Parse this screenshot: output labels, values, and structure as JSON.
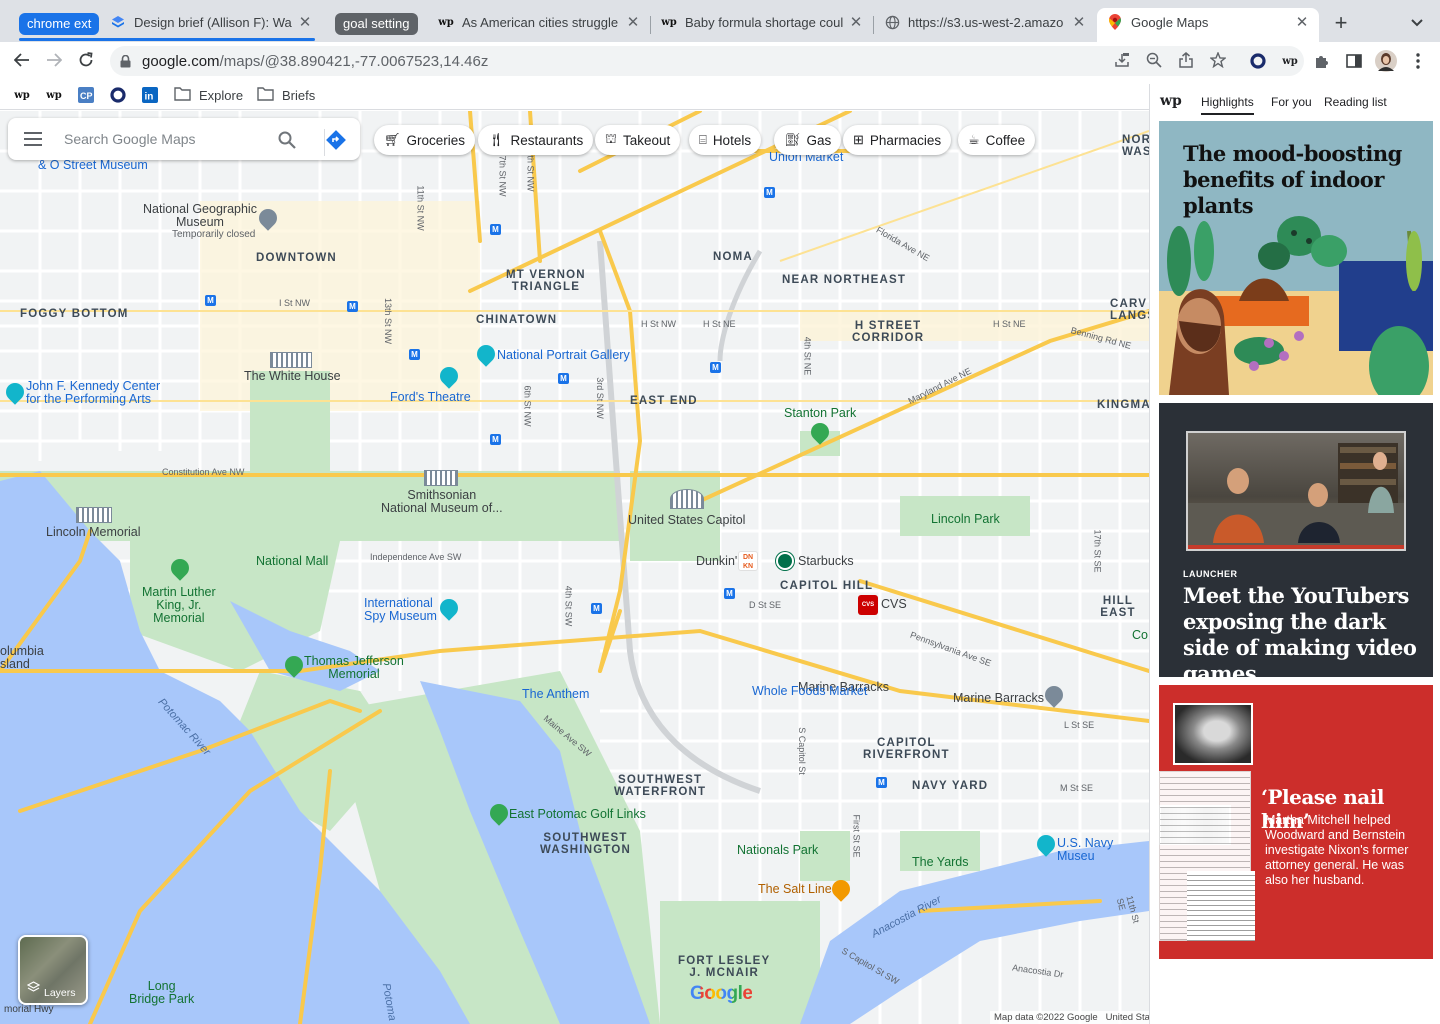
{
  "tabs": {
    "groups": [
      {
        "label": "chrome ext",
        "color": "#1a73e8"
      },
      {
        "label": "goal setting",
        "color": "#5f6368"
      }
    ],
    "items": [
      {
        "title": "Design brief (Allison F): Was",
        "icon": "design-doc-icon"
      },
      {
        "title": "As American cities struggle",
        "icon": "wapo-icon"
      },
      {
        "title": "Baby formula shortage coul",
        "icon": "wapo-icon"
      },
      {
        "title": "https://s3.us-west-2.amazo",
        "icon": "globe-icon"
      },
      {
        "title": "Google Maps",
        "icon": "google-maps-icon"
      }
    ]
  },
  "toolbar": {
    "url_host": "google.com",
    "url_path": "/maps/@38.890421,-77.0067523,14.46z"
  },
  "bookmarks": {
    "folders": [
      "Explore",
      "Briefs"
    ]
  },
  "map": {
    "search_placeholder": "Search Google Maps",
    "chips": [
      "Groceries",
      "Restaurants",
      "Takeout",
      "Hotels",
      "Gas",
      "Pharmacies",
      "Coffee"
    ],
    "areas": {
      "downtown": "DOWNTOWN",
      "foggy_bottom": "FOGGY BOTTOM",
      "mt_vernon": "MT VERNON\nTRIANGLE",
      "chinatown": "CHINATOWN",
      "noma": "NOMA",
      "near_northeast": "NEAR NORTHEAST",
      "h_street": "H STREET\nCORRIDOR",
      "east_end": "EAST END",
      "kingman": "KINGMA",
      "carver": "CARV\nLANGS",
      "capitol_hill": "CAPITOL HILL",
      "hill_east": "HILL EAST",
      "sw_waterfront": "SOUTHWEST\nWATERFRONT",
      "sw_washington": "SOUTHWEST\nWASHINGTON",
      "capitol_riverfront": "CAPITOL\nRIVERFRONT",
      "navy_yard": "NAVY YARD",
      "fort_mcnair": "FORT LESLEY\nJ. MCNAIR",
      "nw_top": "NOR\nWAS"
    },
    "places": {
      "national_geographic": "National Geographic\nMuseum",
      "temporarily_closed": "Temporarily closed",
      "white_house": "The White House",
      "kennedy_center": "John F. Kennedy Center\nfor the Performing Arts",
      "fords_theatre": "Ford's Theatre",
      "portrait_gallery": "National Portrait Gallery",
      "union_market": "Union Market",
      "o_street_museum": "& O Street Museum",
      "smithsonian": "Smithsonian\nNational Museum of...",
      "capitol": "United States Capitol",
      "lincoln_memorial": "Lincoln Memorial",
      "national_mall": "National Mall",
      "mlk": "Martin Luther\nKing, Jr.\nMemorial",
      "spy_museum": "International\nSpy Museum",
      "jefferson": "Thomas Jefferson\nMemorial",
      "stanton_park": "Stanton Park",
      "lincoln_park": "Lincoln Park",
      "dunkin": "Dunkin'",
      "starbucks": "Starbucks",
      "cvs": "CVS",
      "marine_barracks": "Marine Barracks",
      "whole_foods": "Whole Foods Market",
      "anthem": "The Anthem",
      "golf": "East Potomac Golf Links",
      "nationals_park": "Nationals Park",
      "salt_line": "The Salt Line",
      "yards": "The Yards",
      "navy_museum": "U.S. Navy Museu",
      "columbia_island": "olumbia\nsland",
      "long_bridge": "Long\nBridge Park",
      "co": "Co",
      "memorial_hwy": "morial Hwy"
    },
    "streets": {
      "i_st": "I St NW",
      "h_st_nw": "H St NW",
      "h_st_ne": "H St NE",
      "h_st_ne2": "H St NE",
      "constitution": "Constitution Ave NW",
      "independence": "Independence Ave SW",
      "florida": "Florida Ave NE",
      "maryland": "Maryland Ave NE",
      "benning": "Benning Rd NE",
      "pennsylvania": "Pennsylvania Ave SE",
      "d_st_se": "D St SE",
      "m_st_se": "M St SE",
      "l_st_se": "L St SE",
      "maine_ave": "Maine Ave SW",
      "anacostia_dr": "Anacostia Dr",
      "s_capitol": "S Capitol St SW",
      "st11": "11th St NW",
      "st13": "13th St NW",
      "st7": "7th St NW",
      "st6": "6th St NW",
      "st9": "9th St NW",
      "st3": "3rd St NW",
      "st4": "4th St SW",
      "st4ne": "4th St NE",
      "s_capitol_st": "S Capitol St",
      "first_se": "First St SE",
      "st17": "17th St SE",
      "st11se": "11th St SE"
    },
    "water": {
      "potomac": "Potomac River",
      "anacostia": "Anacostia River",
      "potomac2": "Potoma"
    },
    "layers_label": "Layers",
    "attribution": "Map data ©2022 Google",
    "region": "United Stat",
    "google_logo": "Google"
  },
  "side_panel": {
    "tabs": [
      "Highlights",
      "For you",
      "Reading list"
    ],
    "card1_title": "The mood-boosting benefits of indoor plants",
    "card2_kicker": "LAUNCHER",
    "card2_title": "Meet the YouTubers exposing the dark side of making video games",
    "card3_title": "‘Please nail him’",
    "card3_body": "Martha Mitchell helped Woodward and Bernstein investigate Nixon's former attorney general. He was also her husband."
  },
  "colors": {
    "tabstrip": "#dee1e6",
    "road_major": "#fbd15e",
    "park": "#c7e6c6",
    "water": "#a8c7fa",
    "wapo_red": "#cc2e2b"
  }
}
